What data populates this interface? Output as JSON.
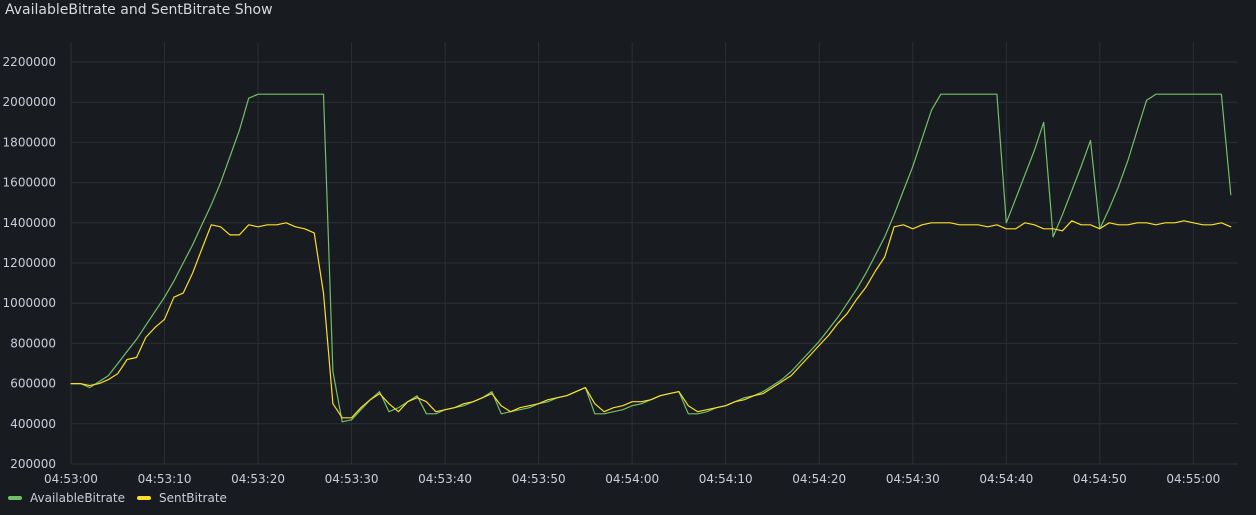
{
  "panel": {
    "title": "AvailableBitrate and SentBitrate Show"
  },
  "colors": {
    "background": "#181b1f",
    "grid": "#2c2f34",
    "text": "#ccccdc"
  },
  "chart_data": {
    "type": "line",
    "title": "AvailableBitrate and SentBitrate Show",
    "xlabel": "",
    "ylabel": "",
    "x_time_range": [
      "04:53:00",
      "04:55:05"
    ],
    "ylim": [
      200000,
      2300000
    ],
    "grid": true,
    "legend_placement": "bottom-left",
    "y_ticks": [
      200000,
      400000,
      600000,
      800000,
      1000000,
      1200000,
      1400000,
      1600000,
      1800000,
      2000000,
      2200000
    ],
    "x_ticks": [
      "04:53:00",
      "04:53:10",
      "04:53:20",
      "04:53:30",
      "04:53:40",
      "04:53:50",
      "04:54:00",
      "04:54:10",
      "04:54:20",
      "04:54:30",
      "04:54:40",
      "04:54:50",
      "04:55:00"
    ],
    "series": [
      {
        "name": "AvailableBitrate",
        "color": "#73bf69",
        "points": [
          [
            "04:53:00",
            600000
          ],
          [
            "04:53:01",
            600000
          ],
          [
            "04:53:02",
            580000
          ],
          [
            "04:53:03",
            610000
          ],
          [
            "04:53:04",
            640000
          ],
          [
            "04:53:05",
            700000
          ],
          [
            "04:53:06",
            760000
          ],
          [
            "04:53:07",
            820000
          ],
          [
            "04:53:08",
            890000
          ],
          [
            "04:53:09",
            960000
          ],
          [
            "04:53:10",
            1030000
          ],
          [
            "04:53:11",
            1110000
          ],
          [
            "04:53:12",
            1200000
          ],
          [
            "04:53:13",
            1290000
          ],
          [
            "04:53:14",
            1390000
          ],
          [
            "04:53:15",
            1490000
          ],
          [
            "04:53:16",
            1600000
          ],
          [
            "04:53:17",
            1730000
          ],
          [
            "04:53:18",
            1860000
          ],
          [
            "04:53:19",
            2020000
          ],
          [
            "04:53:20",
            2040000
          ],
          [
            "04:53:21",
            2040000
          ],
          [
            "04:53:22",
            2040000
          ],
          [
            "04:53:23",
            2040000
          ],
          [
            "04:53:24",
            2040000
          ],
          [
            "04:53:25",
            2040000
          ],
          [
            "04:53:26",
            2040000
          ],
          [
            "04:53:27",
            2040000
          ],
          [
            "04:53:28",
            660000
          ],
          [
            "04:53:29",
            410000
          ],
          [
            "04:53:30",
            420000
          ],
          [
            "04:53:31",
            470000
          ],
          [
            "04:53:32",
            520000
          ],
          [
            "04:53:33",
            560000
          ],
          [
            "04:53:34",
            460000
          ],
          [
            "04:53:35",
            480000
          ],
          [
            "04:53:36",
            510000
          ],
          [
            "04:53:37",
            540000
          ],
          [
            "04:53:38",
            450000
          ],
          [
            "04:53:39",
            450000
          ],
          [
            "04:53:40",
            470000
          ],
          [
            "04:53:41",
            480000
          ],
          [
            "04:53:42",
            490000
          ],
          [
            "04:53:43",
            510000
          ],
          [
            "04:53:44",
            530000
          ],
          [
            "04:53:45",
            560000
          ],
          [
            "04:53:46",
            450000
          ],
          [
            "04:53:47",
            460000
          ],
          [
            "04:53:48",
            470000
          ],
          [
            "04:53:49",
            480000
          ],
          [
            "04:53:50",
            500000
          ],
          [
            "04:53:51",
            510000
          ],
          [
            "04:53:52",
            530000
          ],
          [
            "04:53:53",
            540000
          ],
          [
            "04:53:54",
            560000
          ],
          [
            "04:53:55",
            580000
          ],
          [
            "04:53:56",
            450000
          ],
          [
            "04:53:57",
            450000
          ],
          [
            "04:53:58",
            460000
          ],
          [
            "04:53:59",
            470000
          ],
          [
            "04:54:00",
            490000
          ],
          [
            "04:54:01",
            500000
          ],
          [
            "04:54:02",
            520000
          ],
          [
            "04:54:03",
            540000
          ],
          [
            "04:54:04",
            550000
          ],
          [
            "04:54:05",
            560000
          ],
          [
            "04:54:06",
            450000
          ],
          [
            "04:54:07",
            450000
          ],
          [
            "04:54:08",
            460000
          ],
          [
            "04:54:09",
            480000
          ],
          [
            "04:54:10",
            490000
          ],
          [
            "04:54:11",
            510000
          ],
          [
            "04:54:12",
            530000
          ],
          [
            "04:54:13",
            540000
          ],
          [
            "04:54:14",
            560000
          ],
          [
            "04:54:15",
            590000
          ],
          [
            "04:54:16",
            620000
          ],
          [
            "04:54:17",
            660000
          ],
          [
            "04:54:18",
            710000
          ],
          [
            "04:54:19",
            760000
          ],
          [
            "04:54:20",
            810000
          ],
          [
            "04:54:21",
            870000
          ],
          [
            "04:54:22",
            930000
          ],
          [
            "04:54:23",
            1000000
          ],
          [
            "04:54:24",
            1070000
          ],
          [
            "04:54:25",
            1150000
          ],
          [
            "04:54:26",
            1240000
          ],
          [
            "04:54:27",
            1330000
          ],
          [
            "04:54:28",
            1440000
          ],
          [
            "04:54:29",
            1560000
          ],
          [
            "04:54:30",
            1680000
          ],
          [
            "04:54:31",
            1820000
          ],
          [
            "04:54:32",
            1960000
          ],
          [
            "04:54:33",
            2040000
          ],
          [
            "04:54:34",
            2040000
          ],
          [
            "04:54:35",
            2040000
          ],
          [
            "04:54:36",
            2040000
          ],
          [
            "04:54:37",
            2040000
          ],
          [
            "04:54:38",
            2040000
          ],
          [
            "04:54:39",
            2040000
          ],
          [
            "04:54:40",
            1400000
          ],
          [
            "04:54:41",
            1520000
          ],
          [
            "04:54:42",
            1640000
          ],
          [
            "04:54:43",
            1760000
          ],
          [
            "04:54:44",
            1900000
          ],
          [
            "04:54:45",
            1330000
          ],
          [
            "04:54:46",
            1440000
          ],
          [
            "04:54:47",
            1560000
          ],
          [
            "04:54:48",
            1680000
          ],
          [
            "04:54:49",
            1810000
          ],
          [
            "04:54:50",
            1370000
          ],
          [
            "04:54:51",
            1470000
          ],
          [
            "04:54:52",
            1580000
          ],
          [
            "04:54:53",
            1710000
          ],
          [
            "04:54:54",
            1860000
          ],
          [
            "04:54:55",
            2010000
          ],
          [
            "04:54:56",
            2040000
          ],
          [
            "04:54:57",
            2040000
          ],
          [
            "04:54:58",
            2040000
          ],
          [
            "04:54:59",
            2040000
          ],
          [
            "04:55:00",
            2040000
          ],
          [
            "04:55:01",
            2040000
          ],
          [
            "04:55:02",
            2040000
          ],
          [
            "04:55:03",
            2040000
          ],
          [
            "04:55:04",
            1540000
          ]
        ]
      },
      {
        "name": "SentBitrate",
        "color": "#fade2a",
        "points": [
          [
            "04:53:00",
            600000
          ],
          [
            "04:53:01",
            600000
          ],
          [
            "04:53:02",
            590000
          ],
          [
            "04:53:03",
            600000
          ],
          [
            "04:53:04",
            620000
          ],
          [
            "04:53:05",
            650000
          ],
          [
            "04:53:06",
            720000
          ],
          [
            "04:53:07",
            730000
          ],
          [
            "04:53:08",
            830000
          ],
          [
            "04:53:09",
            880000
          ],
          [
            "04:53:10",
            920000
          ],
          [
            "04:53:11",
            1030000
          ],
          [
            "04:53:12",
            1050000
          ],
          [
            "04:53:13",
            1150000
          ],
          [
            "04:53:14",
            1270000
          ],
          [
            "04:53:15",
            1390000
          ],
          [
            "04:53:16",
            1380000
          ],
          [
            "04:53:17",
            1340000
          ],
          [
            "04:53:18",
            1340000
          ],
          [
            "04:53:19",
            1390000
          ],
          [
            "04:53:20",
            1380000
          ],
          [
            "04:53:21",
            1390000
          ],
          [
            "04:53:22",
            1390000
          ],
          [
            "04:53:23",
            1400000
          ],
          [
            "04:53:24",
            1380000
          ],
          [
            "04:53:25",
            1370000
          ],
          [
            "04:53:26",
            1350000
          ],
          [
            "04:53:27",
            1050000
          ],
          [
            "04:53:28",
            500000
          ],
          [
            "04:53:29",
            430000
          ],
          [
            "04:53:30",
            430000
          ],
          [
            "04:53:31",
            480000
          ],
          [
            "04:53:32",
            520000
          ],
          [
            "04:53:33",
            550000
          ],
          [
            "04:53:34",
            500000
          ],
          [
            "04:53:35",
            460000
          ],
          [
            "04:53:36",
            510000
          ],
          [
            "04:53:37",
            530000
          ],
          [
            "04:53:38",
            510000
          ],
          [
            "04:53:39",
            460000
          ],
          [
            "04:53:40",
            470000
          ],
          [
            "04:53:41",
            480000
          ],
          [
            "04:53:42",
            500000
          ],
          [
            "04:53:43",
            510000
          ],
          [
            "04:53:44",
            530000
          ],
          [
            "04:53:45",
            550000
          ],
          [
            "04:53:46",
            490000
          ],
          [
            "04:53:47",
            460000
          ],
          [
            "04:53:48",
            480000
          ],
          [
            "04:53:49",
            490000
          ],
          [
            "04:53:50",
            500000
          ],
          [
            "04:53:51",
            520000
          ],
          [
            "04:53:52",
            530000
          ],
          [
            "04:53:53",
            540000
          ],
          [
            "04:53:54",
            560000
          ],
          [
            "04:53:55",
            580000
          ],
          [
            "04:53:56",
            500000
          ],
          [
            "04:53:57",
            460000
          ],
          [
            "04:53:58",
            480000
          ],
          [
            "04:53:59",
            490000
          ],
          [
            "04:54:00",
            510000
          ],
          [
            "04:54:01",
            510000
          ],
          [
            "04:54:02",
            520000
          ],
          [
            "04:54:03",
            540000
          ],
          [
            "04:54:04",
            550000
          ],
          [
            "04:54:05",
            560000
          ],
          [
            "04:54:06",
            490000
          ],
          [
            "04:54:07",
            460000
          ],
          [
            "04:54:08",
            470000
          ],
          [
            "04:54:09",
            480000
          ],
          [
            "04:54:10",
            490000
          ],
          [
            "04:54:11",
            510000
          ],
          [
            "04:54:12",
            520000
          ],
          [
            "04:54:13",
            540000
          ],
          [
            "04:54:14",
            550000
          ],
          [
            "04:54:15",
            580000
          ],
          [
            "04:54:16",
            610000
          ],
          [
            "04:54:17",
            640000
          ],
          [
            "04:54:18",
            690000
          ],
          [
            "04:54:19",
            740000
          ],
          [
            "04:54:20",
            790000
          ],
          [
            "04:54:21",
            840000
          ],
          [
            "04:54:22",
            900000
          ],
          [
            "04:54:23",
            950000
          ],
          [
            "04:54:24",
            1020000
          ],
          [
            "04:54:25",
            1080000
          ],
          [
            "04:54:26",
            1160000
          ],
          [
            "04:54:27",
            1230000
          ],
          [
            "04:54:28",
            1380000
          ],
          [
            "04:54:29",
            1390000
          ],
          [
            "04:54:30",
            1370000
          ],
          [
            "04:54:31",
            1390000
          ],
          [
            "04:54:32",
            1400000
          ],
          [
            "04:54:33",
            1400000
          ],
          [
            "04:54:34",
            1400000
          ],
          [
            "04:54:35",
            1390000
          ],
          [
            "04:54:36",
            1390000
          ],
          [
            "04:54:37",
            1390000
          ],
          [
            "04:54:38",
            1380000
          ],
          [
            "04:54:39",
            1390000
          ],
          [
            "04:54:40",
            1370000
          ],
          [
            "04:54:41",
            1370000
          ],
          [
            "04:54:42",
            1400000
          ],
          [
            "04:54:43",
            1390000
          ],
          [
            "04:54:44",
            1370000
          ],
          [
            "04:54:45",
            1370000
          ],
          [
            "04:54:46",
            1360000
          ],
          [
            "04:54:47",
            1410000
          ],
          [
            "04:54:48",
            1390000
          ],
          [
            "04:54:49",
            1390000
          ],
          [
            "04:54:50",
            1370000
          ],
          [
            "04:54:51",
            1400000
          ],
          [
            "04:54:52",
            1390000
          ],
          [
            "04:54:53",
            1390000
          ],
          [
            "04:54:54",
            1400000
          ],
          [
            "04:54:55",
            1400000
          ],
          [
            "04:54:56",
            1390000
          ],
          [
            "04:54:57",
            1400000
          ],
          [
            "04:54:58",
            1400000
          ],
          [
            "04:54:59",
            1410000
          ],
          [
            "04:55:00",
            1400000
          ],
          [
            "04:55:01",
            1390000
          ],
          [
            "04:55:02",
            1390000
          ],
          [
            "04:55:03",
            1400000
          ],
          [
            "04:55:04",
            1380000
          ]
        ]
      }
    ]
  }
}
